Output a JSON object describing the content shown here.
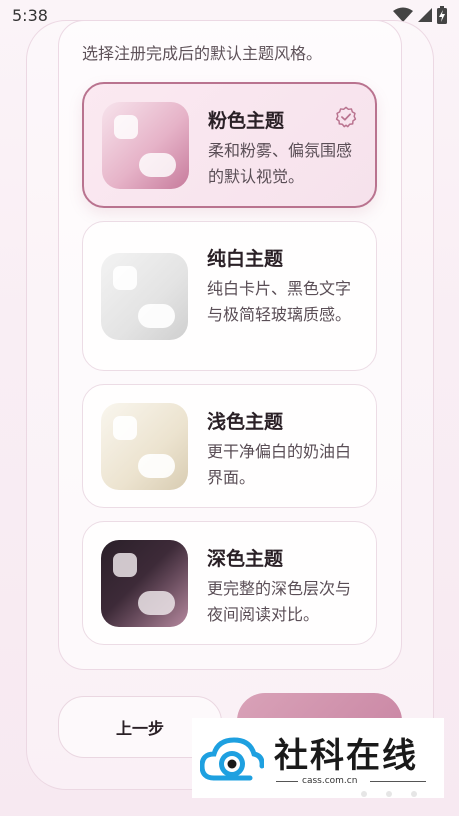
{
  "status_bar": {
    "time": "5:38"
  },
  "screen": {
    "subtitle": "选择注册完成后的默认主题风格。",
    "themes": [
      {
        "title": "粉色主题",
        "description": "柔和粉雾、偏氛围感的默认视觉。",
        "selected": true,
        "thumbnail": "pink"
      },
      {
        "title": "纯白主题",
        "description": "纯白卡片、黑色文字与极简轻玻璃质感。",
        "selected": false,
        "thumbnail": "white"
      },
      {
        "title": "浅色主题",
        "description": "更干净偏白的奶油白界面。",
        "selected": false,
        "thumbnail": "cream"
      },
      {
        "title": "深色主题",
        "description": "更完整的深色层次与夜间阅读对比。",
        "selected": false,
        "thumbnail": "dark"
      }
    ],
    "prev_button_label": "上一步"
  },
  "watermark": {
    "brand": "社科在线",
    "url": "cass.com.cn"
  },
  "colors": {
    "accent": "#b9738f",
    "next_button": "#c884a2",
    "background": "#f9eef4"
  },
  "icons": {
    "wifi": "wifi-icon",
    "signal": "signal-icon",
    "battery": "battery-icon",
    "check": "check-badge-icon"
  }
}
